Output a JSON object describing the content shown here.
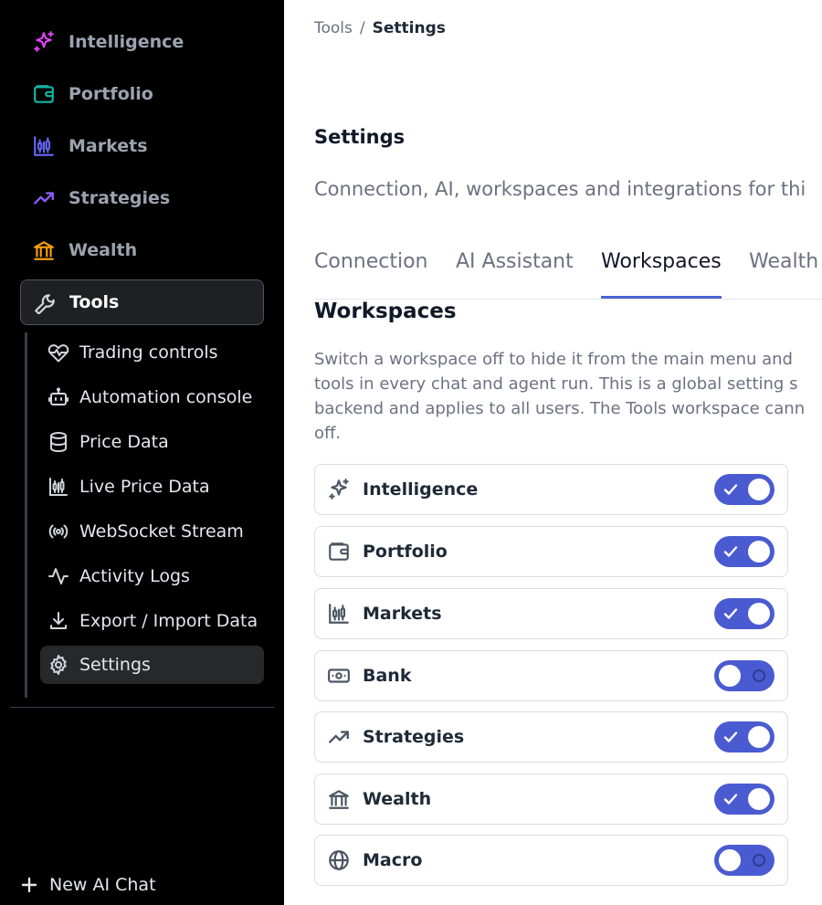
{
  "sidebar": {
    "nav": [
      {
        "label": "Intelligence",
        "icon": "sparkles-icon",
        "color": "#d946ef"
      },
      {
        "label": "Portfolio",
        "icon": "wallet-icon",
        "color": "#14b8a6"
      },
      {
        "label": "Markets",
        "icon": "candlestick-icon",
        "color": "#6366f1"
      },
      {
        "label": "Strategies",
        "icon": "trending-up-icon",
        "color": "#8b5cf6"
      },
      {
        "label": "Wealth",
        "icon": "bank-icon",
        "color": "#f59e0b"
      },
      {
        "label": "Tools",
        "icon": "wrench-icon",
        "color": "#d1d5db",
        "active": true
      }
    ],
    "tools_subnav": [
      {
        "label": "Trading controls",
        "icon": "heart-pulse-icon"
      },
      {
        "label": "Automation console",
        "icon": "robot-icon"
      },
      {
        "label": "Price Data",
        "icon": "database-icon"
      },
      {
        "label": "Live Price Data",
        "icon": "candlestick-icon"
      },
      {
        "label": "WebSocket Stream",
        "icon": "broadcast-icon"
      },
      {
        "label": "Activity Logs",
        "icon": "activity-icon"
      },
      {
        "label": "Export / Import Data",
        "icon": "download-icon"
      },
      {
        "label": "Settings",
        "icon": "gear-icon",
        "active": true
      }
    ],
    "new_chat_label": "New AI Chat"
  },
  "breadcrumb": {
    "parent": "Tools",
    "separator": "/",
    "current": "Settings"
  },
  "page": {
    "title": "Settings",
    "subtitle": "Connection, AI, workspaces and integrations for thi"
  },
  "tabs": [
    {
      "label": "Connection"
    },
    {
      "label": "AI Assistant"
    },
    {
      "label": "Workspaces",
      "active": true
    },
    {
      "label": "Wealth"
    }
  ],
  "workspaces": {
    "title": "Workspaces",
    "description_lines": [
      "Switch a workspace off to hide it from the main menu and",
      "tools in every chat and agent run. This is a global setting s",
      "backend and applies to all users. The Tools workspace cann",
      "off."
    ],
    "items": [
      {
        "label": "Intelligence",
        "icon": "sparkles-icon",
        "enabled": true
      },
      {
        "label": "Portfolio",
        "icon": "wallet-icon",
        "enabled": true
      },
      {
        "label": "Markets",
        "icon": "candlestick-icon",
        "enabled": true
      },
      {
        "label": "Bank",
        "icon": "banknote-icon",
        "enabled": false
      },
      {
        "label": "Strategies",
        "icon": "trending-up-icon",
        "enabled": true
      },
      {
        "label": "Wealth",
        "icon": "bank-icon",
        "enabled": true
      },
      {
        "label": "Macro",
        "icon": "globe-icon",
        "enabled": false
      }
    ]
  },
  "colors": {
    "sidebar_bg": "#000000",
    "accent": "#4a5bd1",
    "text_dark": "#111827",
    "text_muted": "#6b7280"
  }
}
